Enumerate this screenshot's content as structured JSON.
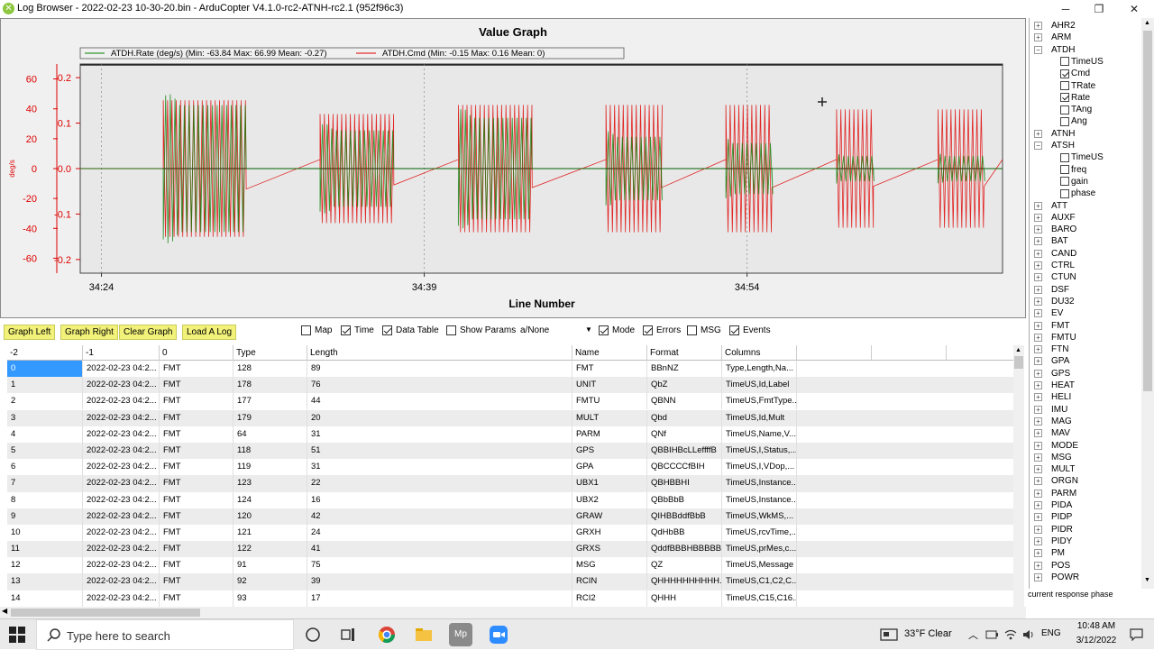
{
  "window": {
    "title": "Log Browser - 2022-02-23 10-30-20.bin - ArduCopter V4.1.0-rc2-ATNH-rc2.1 (952f96c3)",
    "minimize": "─",
    "maximize": "❐",
    "close": "✕"
  },
  "graph": {
    "title": "Value Graph",
    "xlabel": "Line Number",
    "ylabel": "deg/s",
    "legend": [
      {
        "label": "ATDH.Rate (deg/s)  (Min: -63.84 Max: 66.99 Mean: -0.27)",
        "color": "#008000"
      },
      {
        "label": "ATDH.Cmd  (Min: -0.15 Max: 0.16 Mean: 0)",
        "color": "#e00000"
      }
    ],
    "y_left_ticks": [
      "60",
      "40",
      "20",
      "0",
      "-20",
      "-40",
      "-60"
    ],
    "y_right_ticks": [
      "0.2",
      "0.1",
      "0.0",
      "-0.1",
      "-0.2"
    ],
    "x_ticks": [
      "34:24",
      "34:39",
      "34:54"
    ]
  },
  "chart_data": {
    "type": "line",
    "title": "Value Graph",
    "xlabel": "Line Number",
    "ylabel": "deg/s",
    "x_ticks": [
      "34:24",
      "34:39",
      "34:54"
    ],
    "ylim_left": [
      -70,
      70
    ],
    "ylim_right": [
      -0.23,
      0.23
    ],
    "series": [
      {
        "name": "ATDH.Rate (deg/s)",
        "axis": "left",
        "color": "#008000",
        "min": -63.84,
        "max": 66.99,
        "mean": -0.27,
        "bursts": [
          [
            0.09,
            0.18,
            50
          ],
          [
            0.26,
            0.34,
            30
          ],
          [
            0.41,
            0.49,
            40
          ],
          [
            0.57,
            0.63,
            25
          ],
          [
            0.7,
            0.75,
            20
          ],
          [
            0.82,
            0.86,
            10
          ],
          [
            0.93,
            0.98,
            10
          ]
        ]
      },
      {
        "name": "ATDH.Cmd",
        "axis": "right",
        "color": "#e00000",
        "min": -0.15,
        "max": 0.16,
        "mean": 0,
        "bursts": [
          [
            0.09,
            0.18,
            0.15
          ],
          [
            0.26,
            0.34,
            0.12
          ],
          [
            0.41,
            0.49,
            0.14
          ],
          [
            0.57,
            0.63,
            0.14
          ],
          [
            0.7,
            0.75,
            0.14
          ],
          [
            0.82,
            0.86,
            0.13
          ],
          [
            0.93,
            0.98,
            0.13
          ]
        ]
      }
    ],
    "grid": true,
    "legend_position": "top"
  },
  "toolbar": {
    "graph_left": "Graph Left",
    "graph_right": "Graph Right",
    "clear_graph": "Clear Graph",
    "load_log": "Load A Log",
    "checks": [
      {
        "label": "Map",
        "checked": false
      },
      {
        "label": "Time",
        "checked": true
      },
      {
        "label": "Data Table",
        "checked": true
      },
      {
        "label": "Show Params",
        "checked": false
      }
    ],
    "mode_select": "a/None",
    "checks2": [
      {
        "label": "Mode",
        "checked": true
      },
      {
        "label": "Errors",
        "checked": true
      },
      {
        "label": "MSG",
        "checked": false
      },
      {
        "label": "Events",
        "checked": true
      }
    ]
  },
  "table": {
    "headers": [
      "-2",
      "-1",
      "0",
      "Type",
      "Length",
      "Name",
      "Format",
      "Columns"
    ],
    "rows": [
      [
        "0",
        "2022-02-23 04:2...",
        "FMT",
        "128",
        "89",
        "FMT",
        "BBnNZ",
        "Type,Length,Na..."
      ],
      [
        "1",
        "2022-02-23 04:2...",
        "FMT",
        "178",
        "76",
        "UNIT",
        "QbZ",
        "TimeUS,Id,Label"
      ],
      [
        "2",
        "2022-02-23 04:2...",
        "FMT",
        "177",
        "44",
        "FMTU",
        "QBNN",
        "TimeUS,FmtType..."
      ],
      [
        "3",
        "2022-02-23 04:2...",
        "FMT",
        "179",
        "20",
        "MULT",
        "Qbd",
        "TimeUS,Id,Mult"
      ],
      [
        "4",
        "2022-02-23 04:2...",
        "FMT",
        "64",
        "31",
        "PARM",
        "QNf",
        "TimeUS,Name,V..."
      ],
      [
        "5",
        "2022-02-23 04:2...",
        "FMT",
        "118",
        "51",
        "GPS",
        "QBBIHBcLLeffffB",
        "TimeUS,I,Status,..."
      ],
      [
        "6",
        "2022-02-23 04:2...",
        "FMT",
        "119",
        "31",
        "GPA",
        "QBCCCCfBIH",
        "TimeUS,I,VDop,..."
      ],
      [
        "7",
        "2022-02-23 04:2...",
        "FMT",
        "123",
        "22",
        "UBX1",
        "QBHBBHI",
        "TimeUS,Instance..."
      ],
      [
        "8",
        "2022-02-23 04:2...",
        "FMT",
        "124",
        "16",
        "UBX2",
        "QBbBbB",
        "TimeUS,Instance..."
      ],
      [
        "9",
        "2022-02-23 04:2...",
        "FMT",
        "120",
        "42",
        "GRAW",
        "QIHBBddfBbB",
        "TimeUS,WkMS,..."
      ],
      [
        "10",
        "2022-02-23 04:2...",
        "FMT",
        "121",
        "24",
        "GRXH",
        "QdHbBB",
        "TimeUS,rcvTime,..."
      ],
      [
        "11",
        "2022-02-23 04:2...",
        "FMT",
        "122",
        "41",
        "GRXS",
        "QddfBBBHBBBBB",
        "TimeUS,prMes,c..."
      ],
      [
        "12",
        "2022-02-23 04:2...",
        "FMT",
        "91",
        "75",
        "MSG",
        "QZ",
        "TimeUS,Message"
      ],
      [
        "13",
        "2022-02-23 04:2...",
        "FMT",
        "92",
        "39",
        "RCIN",
        "QHHHHHHHHHH...",
        "TimeUS,C1,C2,C..."
      ],
      [
        "14",
        "2022-02-23 04:2...",
        "FMT",
        "93",
        "17",
        "RCI2",
        "QHHH",
        "TimeUS,C15,C16..."
      ]
    ]
  },
  "tree": {
    "items": [
      {
        "label": "AHR2",
        "level": 0,
        "exp": "+"
      },
      {
        "label": "ARM",
        "level": 0,
        "exp": "+"
      },
      {
        "label": "ATDH",
        "level": 0,
        "exp": "−"
      },
      {
        "label": "TimeUS",
        "level": 1,
        "checked": false
      },
      {
        "label": "Cmd",
        "level": 1,
        "checked": true
      },
      {
        "label": "TRate",
        "level": 1,
        "checked": false
      },
      {
        "label": "Rate",
        "level": 1,
        "checked": true
      },
      {
        "label": "TAng",
        "level": 1,
        "checked": false
      },
      {
        "label": "Ang",
        "level": 1,
        "checked": false
      },
      {
        "label": "ATNH",
        "level": 0,
        "exp": "+"
      },
      {
        "label": "ATSH",
        "level": 0,
        "exp": "−"
      },
      {
        "label": "TimeUS",
        "level": 1,
        "checked": false
      },
      {
        "label": "freq",
        "level": 1,
        "checked": false
      },
      {
        "label": "gain",
        "level": 1,
        "checked": false
      },
      {
        "label": "phase",
        "level": 1,
        "checked": false
      },
      {
        "label": "ATT",
        "level": 0,
        "exp": "+"
      },
      {
        "label": "AUXF",
        "level": 0,
        "exp": "+"
      },
      {
        "label": "BARO",
        "level": 0,
        "exp": "+"
      },
      {
        "label": "BAT",
        "level": 0,
        "exp": "+"
      },
      {
        "label": "CAND",
        "level": 0,
        "exp": "+"
      },
      {
        "label": "CTRL",
        "level": 0,
        "exp": "+"
      },
      {
        "label": "CTUN",
        "level": 0,
        "exp": "+"
      },
      {
        "label": "DSF",
        "level": 0,
        "exp": "+"
      },
      {
        "label": "DU32",
        "level": 0,
        "exp": "+"
      },
      {
        "label": "EV",
        "level": 0,
        "exp": "+"
      },
      {
        "label": "FMT",
        "level": 0,
        "exp": "+"
      },
      {
        "label": "FMTU",
        "level": 0,
        "exp": "+"
      },
      {
        "label": "FTN",
        "level": 0,
        "exp": "+"
      },
      {
        "label": "GPA",
        "level": 0,
        "exp": "+"
      },
      {
        "label": "GPS",
        "level": 0,
        "exp": "+"
      },
      {
        "label": "HEAT",
        "level": 0,
        "exp": "+"
      },
      {
        "label": "HELI",
        "level": 0,
        "exp": "+"
      },
      {
        "label": "IMU",
        "level": 0,
        "exp": "+"
      },
      {
        "label": "MAG",
        "level": 0,
        "exp": "+"
      },
      {
        "label": "MAV",
        "level": 0,
        "exp": "+"
      },
      {
        "label": "MODE",
        "level": 0,
        "exp": "+"
      },
      {
        "label": "MSG",
        "level": 0,
        "exp": "+"
      },
      {
        "label": "MULT",
        "level": 0,
        "exp": "+"
      },
      {
        "label": "ORGN",
        "level": 0,
        "exp": "+"
      },
      {
        "label": "PARM",
        "level": 0,
        "exp": "+"
      },
      {
        "label": "PIDA",
        "level": 0,
        "exp": "+"
      },
      {
        "label": "PIDP",
        "level": 0,
        "exp": "+"
      },
      {
        "label": "PIDR",
        "level": 0,
        "exp": "+"
      },
      {
        "label": "PIDY",
        "level": 0,
        "exp": "+"
      },
      {
        "label": "PM",
        "level": 0,
        "exp": "+"
      },
      {
        "label": "POS",
        "level": 0,
        "exp": "+"
      },
      {
        "label": "POWR",
        "level": 0,
        "exp": "+"
      }
    ],
    "status": "current response phase"
  },
  "taskbar": {
    "search_placeholder": "Type here to search",
    "weather": "33°F  Clear",
    "lang": "ENG",
    "time": "10:48 AM",
    "date": "3/12/2022"
  }
}
